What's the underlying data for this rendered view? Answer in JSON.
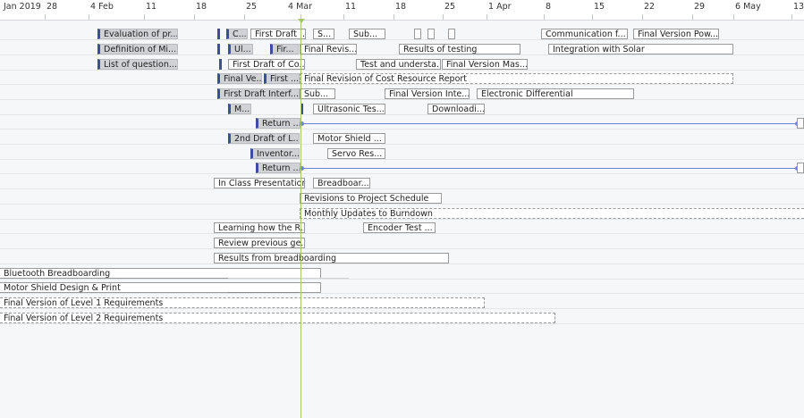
{
  "timeline": {
    "ticks": [
      "Jan 2019",
      "28",
      "4 Feb",
      "11",
      "18",
      "25",
      "4 Mar",
      "11",
      "18",
      "25",
      "1 Apr",
      "8",
      "15",
      "22",
      "29",
      "6 May",
      "13"
    ]
  },
  "tasks": {
    "evaluation": "Evaluation of pr...",
    "definition": "Definition of Mi...",
    "list_questions": "List of question...",
    "c_short": "C...",
    "first_draft_1": "First Draft ...",
    "s_1": "S...",
    "sub_1": "Sub...",
    "communication": "Communication f...",
    "final_version_pow": "Final Version Pow...",
    "ul": "Ul...",
    "fir": "Fir...",
    "final_revis": "Final Revis...",
    "results_testing": "Results of testing",
    "integration_solar": "Integration with Solar",
    "first_draft_co": "First Draft of Co...",
    "test_understa": "Test and understa...",
    "final_version_mas": "Final Version Mas...",
    "final_ve": "Final Ve...",
    "first_dots": "First ...",
    "final_revision_cost": "Final Revision of Cost Resource Report",
    "first_draft_interf": "First Draft Interf...",
    "sub_2": "Sub...",
    "final_version_inte": "Final Version Inte...",
    "electronic_diff": "Electronic Differential",
    "m_short": "M...",
    "ultrasonic": "Ultrasonic Tes...",
    "downloadi": "Downloadi...",
    "return_1": "Return ...",
    "second_draft": "2nd Draft of L...",
    "motor_shield": "Motor Shield ...",
    "inventor": "Inventor...",
    "servo": "Servo Res...",
    "return_2": "Return ...",
    "in_class": "In Class Presentation",
    "breadboar": "Breadboar...",
    "revisions_schedule": "Revisions to Project Schedule",
    "monthly_updates": "Monthly Updates to Burndown",
    "learning_r": "Learning how the R...",
    "encoder_test": "Encoder Test ...",
    "review_previous": "Review previous ge...",
    "results_breadboarding": "Results from breadboarding",
    "bluetooth_breadboarding": "Bluetooth Breadboarding",
    "motor_shield_design": "Motor Shield Design & Print",
    "final_level1": "Final Version of Level 1 Requirements",
    "final_level2": "Final Version of Level 2 Requirements"
  },
  "colors": {
    "accent": "#3b4f9a",
    "today": "#a5c86a",
    "link": "#6b82d8"
  }
}
